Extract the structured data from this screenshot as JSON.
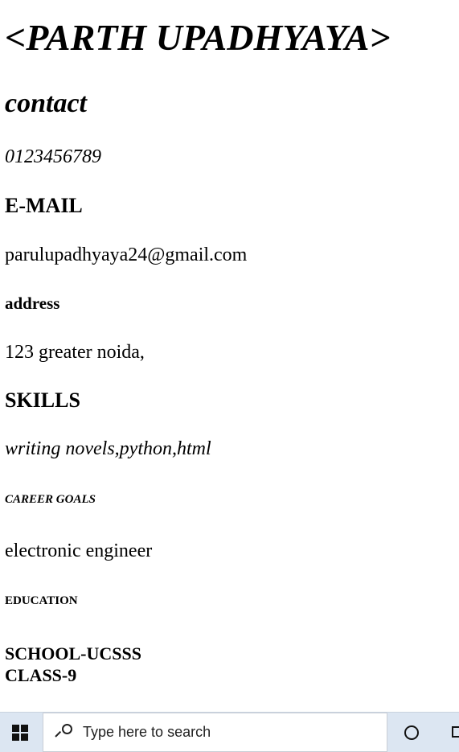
{
  "resume": {
    "name": "<PARTH UPADHYAYA>",
    "contact_heading": "contact",
    "phone": "0123456789",
    "email_heading": "E-MAIL",
    "email": "parulupadhyaya24@gmail.com",
    "address_heading": "address",
    "address": "123 greater noida,",
    "skills_heading": "SKILLS",
    "skills": "writing novels,python,html",
    "career_heading": "CAREER GOALS",
    "career": "electronic engineer",
    "education_heading": "EDUCATION",
    "education_school": "SCHOOL-UCSSS",
    "education_class": "CLASS-9"
  },
  "taskbar": {
    "search_placeholder": "Type here to search",
    "start_icon": "windows-logo-icon",
    "search_icon": "search-icon",
    "cortana_icon": "cortana-icon",
    "taskview_icon": "task-view-icon",
    "background_color": "#dce6f2"
  }
}
